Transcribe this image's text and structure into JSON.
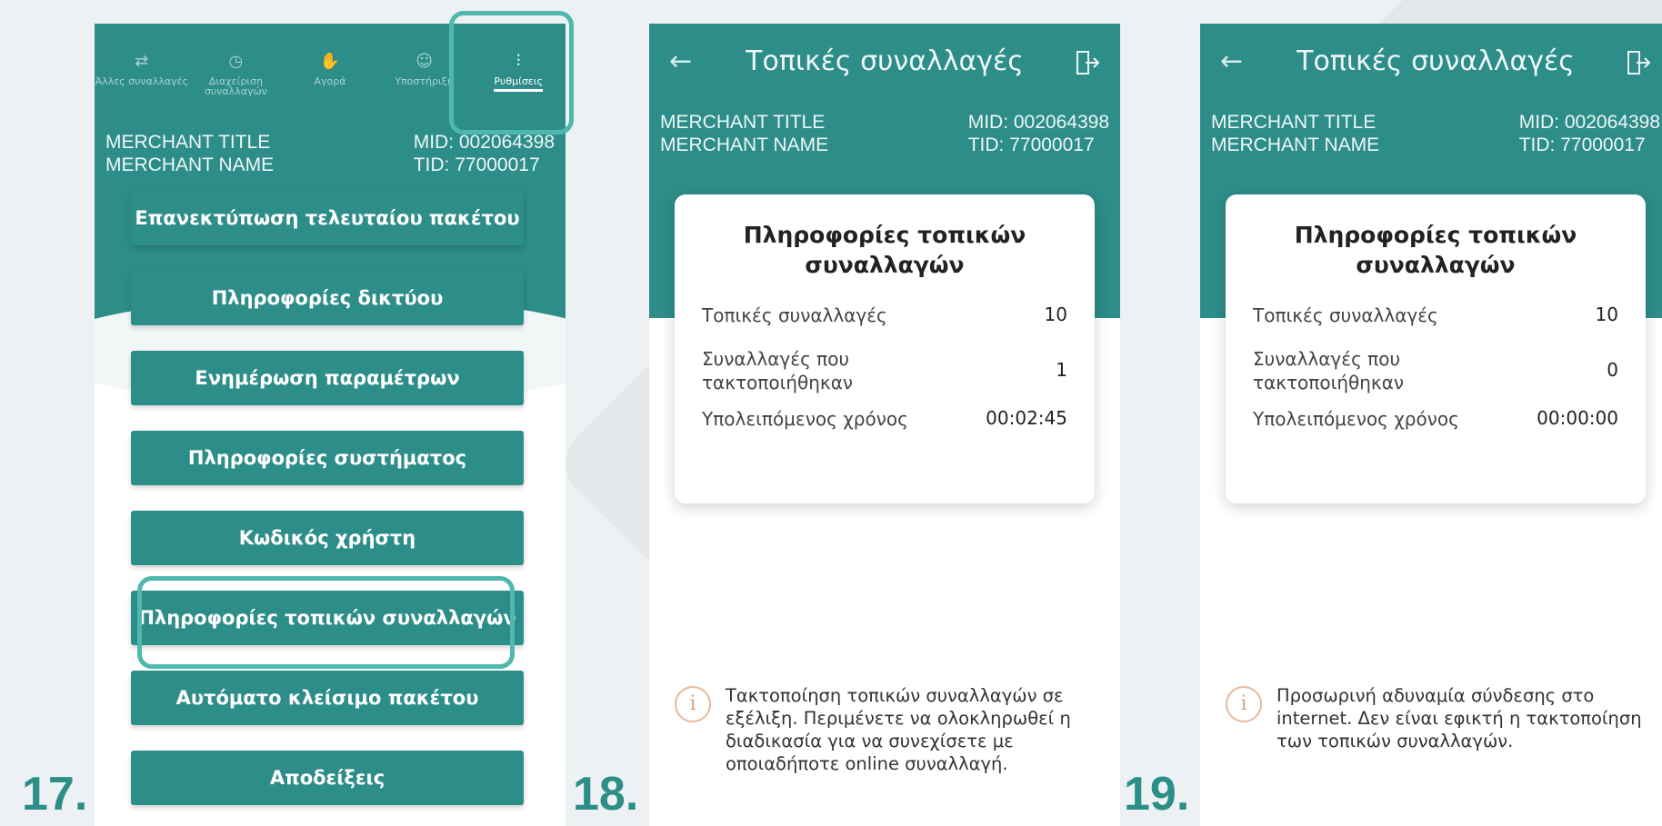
{
  "steps": [
    "17.",
    "18.",
    "19."
  ],
  "colors": {
    "teal": "#2d8d89",
    "highlight": "#4fb8ae",
    "step_number": "#2b8e88",
    "info": "#e0a37a"
  },
  "merchant": {
    "title": "MERCHANT TITLE",
    "name": "MERCHANT NAME",
    "mid": "MID: 002064398",
    "tid": "TID: 77000017"
  },
  "screen17": {
    "tabs": [
      {
        "label": "Άλλες συναλλαγές",
        "icon": "transfer-icon"
      },
      {
        "label": "Διαχείριση συναλλαγών",
        "icon": "clock-icon"
      },
      {
        "label": "Αγορά",
        "icon": "hand-icon"
      },
      {
        "label": "Υποστήριξη",
        "icon": "support-icon"
      },
      {
        "label": "Ρυθμίσεις",
        "icon": "sliders-icon"
      }
    ],
    "menu": [
      "Επανεκτύπωση τελευταίου πακέτου",
      "Πληροφορίες δικτύου",
      "Ενημέρωση παραμέτρων",
      "Πληροφορίες συστήματος",
      "Κωδικός χρήστη",
      "Πληροφορίες τοπικών συναλλαγών",
      "Αυτόματο κλείσιμο πακέτου",
      "Αποδείξεις"
    ]
  },
  "screen18": {
    "nav_title": "Τοπικές συναλλαγές",
    "card_title": "Πληροφορίες τοπικών συναλλαγών",
    "rows": [
      {
        "label": "Τοπικές συναλλαγές",
        "value": "10"
      },
      {
        "label": "Συναλλαγές που τακτοποιήθηκαν",
        "value": "1"
      },
      {
        "label": "Υπολειπόμενος χρόνος",
        "value": "00:02:45"
      }
    ],
    "notice": "Τακτοποίηση τοπικών συναλλαγών σε εξέλιξη. Περιμένετε να ολοκληρωθεί η διαδικασία για να συνεχίσετε με οποιαδήποτε online συναλλαγή."
  },
  "screen19": {
    "nav_title": "Τοπικές συναλλαγές",
    "card_title": "Πληροφορίες τοπικών συναλλαγών",
    "rows": [
      {
        "label": "Τοπικές συναλλαγές",
        "value": "10"
      },
      {
        "label": "Συναλλαγές που τακτοποιήθηκαν",
        "value": "0"
      },
      {
        "label": "Υπολειπόμενος χρόνος",
        "value": "00:00:00"
      }
    ],
    "notice": "Προσωρινή αδυναμία σύνδεσης στο internet. Δεν είναι εφικτή η τακτοποίηση των τοπικών συναλλαγών."
  }
}
